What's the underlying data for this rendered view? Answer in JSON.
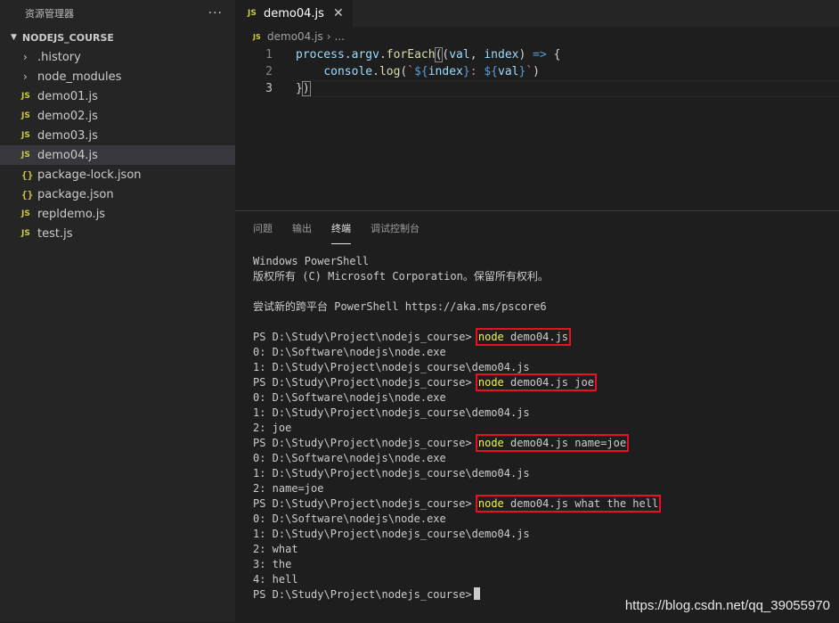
{
  "sidebar": {
    "title": "资源管理器",
    "more": "···",
    "section": "NODEJS_COURSE",
    "items": [
      {
        "label": ".history",
        "kind": "folder"
      },
      {
        "label": "node_modules",
        "kind": "folder"
      },
      {
        "label": "demo01.js",
        "kind": "js"
      },
      {
        "label": "demo02.js",
        "kind": "js"
      },
      {
        "label": "demo03.js",
        "kind": "js"
      },
      {
        "label": "demo04.js",
        "kind": "js",
        "selected": true
      },
      {
        "label": "package-lock.json",
        "kind": "json"
      },
      {
        "label": "package.json",
        "kind": "json"
      },
      {
        "label": "repldemo.js",
        "kind": "js"
      },
      {
        "label": "test.js",
        "kind": "js"
      }
    ]
  },
  "editor": {
    "tab_label": "demo04.js",
    "tab_icon": "JS",
    "breadcrumb_file": "demo04.js",
    "breadcrumb_rest": "...",
    "line_numbers": [
      "1",
      "2",
      "3"
    ],
    "code": {
      "l1_obj": "process",
      "l1_dot1": ".",
      "l1_prop": "argv",
      "l1_dot2": ".",
      "l1_fn": "forEach",
      "l1_open": "(",
      "l1_params_open": "(",
      "l1_p1": "val",
      "l1_comma": ", ",
      "l1_p2": "index",
      "l1_params_close": ")",
      "l1_arrow": " => ",
      "l1_brace": "{",
      "l2_indent": "    ",
      "l2_obj": "console",
      "l2_dot": ".",
      "l2_fn": "log",
      "l2_open": "(",
      "l2_tick1": "`",
      "l2_tmpl1_open": "${",
      "l2_tmpl1_var": "index",
      "l2_tmpl1_close": "}",
      "l2_str_mid": ": ",
      "l2_tmpl2_open": "${",
      "l2_tmpl2_var": "val",
      "l2_tmpl2_close": "}",
      "l2_tick2": "`",
      "l2_close": ")",
      "l3_brace": "}",
      "l3_paren": ")"
    }
  },
  "panel": {
    "tabs": [
      "问题",
      "输出",
      "终端",
      "调试控制台"
    ],
    "active_tab": "终端"
  },
  "terminal": {
    "header": [
      "Windows PowerShell",
      "版权所有 (C) Microsoft Corporation。保留所有权利。",
      "",
      "尝试新的跨平台 PowerShell https://aka.ms/pscore6",
      ""
    ],
    "prompt": "PS D:\\Study\\Project\\nodejs_course> ",
    "runs": [
      {
        "cmd_node": "node",
        "cmd_args": " demo04.js",
        "output": [
          "0: D:\\Software\\nodejs\\node.exe",
          "1: D:\\Study\\Project\\nodejs_course\\demo04.js"
        ]
      },
      {
        "cmd_node": "node",
        "cmd_args": " demo04.js joe",
        "output": [
          "0: D:\\Software\\nodejs\\node.exe",
          "1: D:\\Study\\Project\\nodejs_course\\demo04.js",
          "2: joe"
        ]
      },
      {
        "cmd_node": "node",
        "cmd_args": " demo04.js name=joe",
        "output": [
          "0: D:\\Software\\nodejs\\node.exe",
          "1: D:\\Study\\Project\\nodejs_course\\demo04.js",
          "2: name=joe"
        ]
      },
      {
        "cmd_node": "node",
        "cmd_args": " demo04.js what the hell",
        "output": [
          "0: D:\\Software\\nodejs\\node.exe",
          "1: D:\\Study\\Project\\nodejs_course\\demo04.js",
          "2: what",
          "3: the",
          "4: hell"
        ]
      }
    ],
    "final_prompt": "PS D:\\Study\\Project\\nodejs_course>"
  },
  "watermark": "https://blog.csdn.net/qq_39055970",
  "colors": {
    "highlight_box": "#e81123",
    "node_cmd": "#f1f149",
    "js_icon": "#cbcb41"
  }
}
